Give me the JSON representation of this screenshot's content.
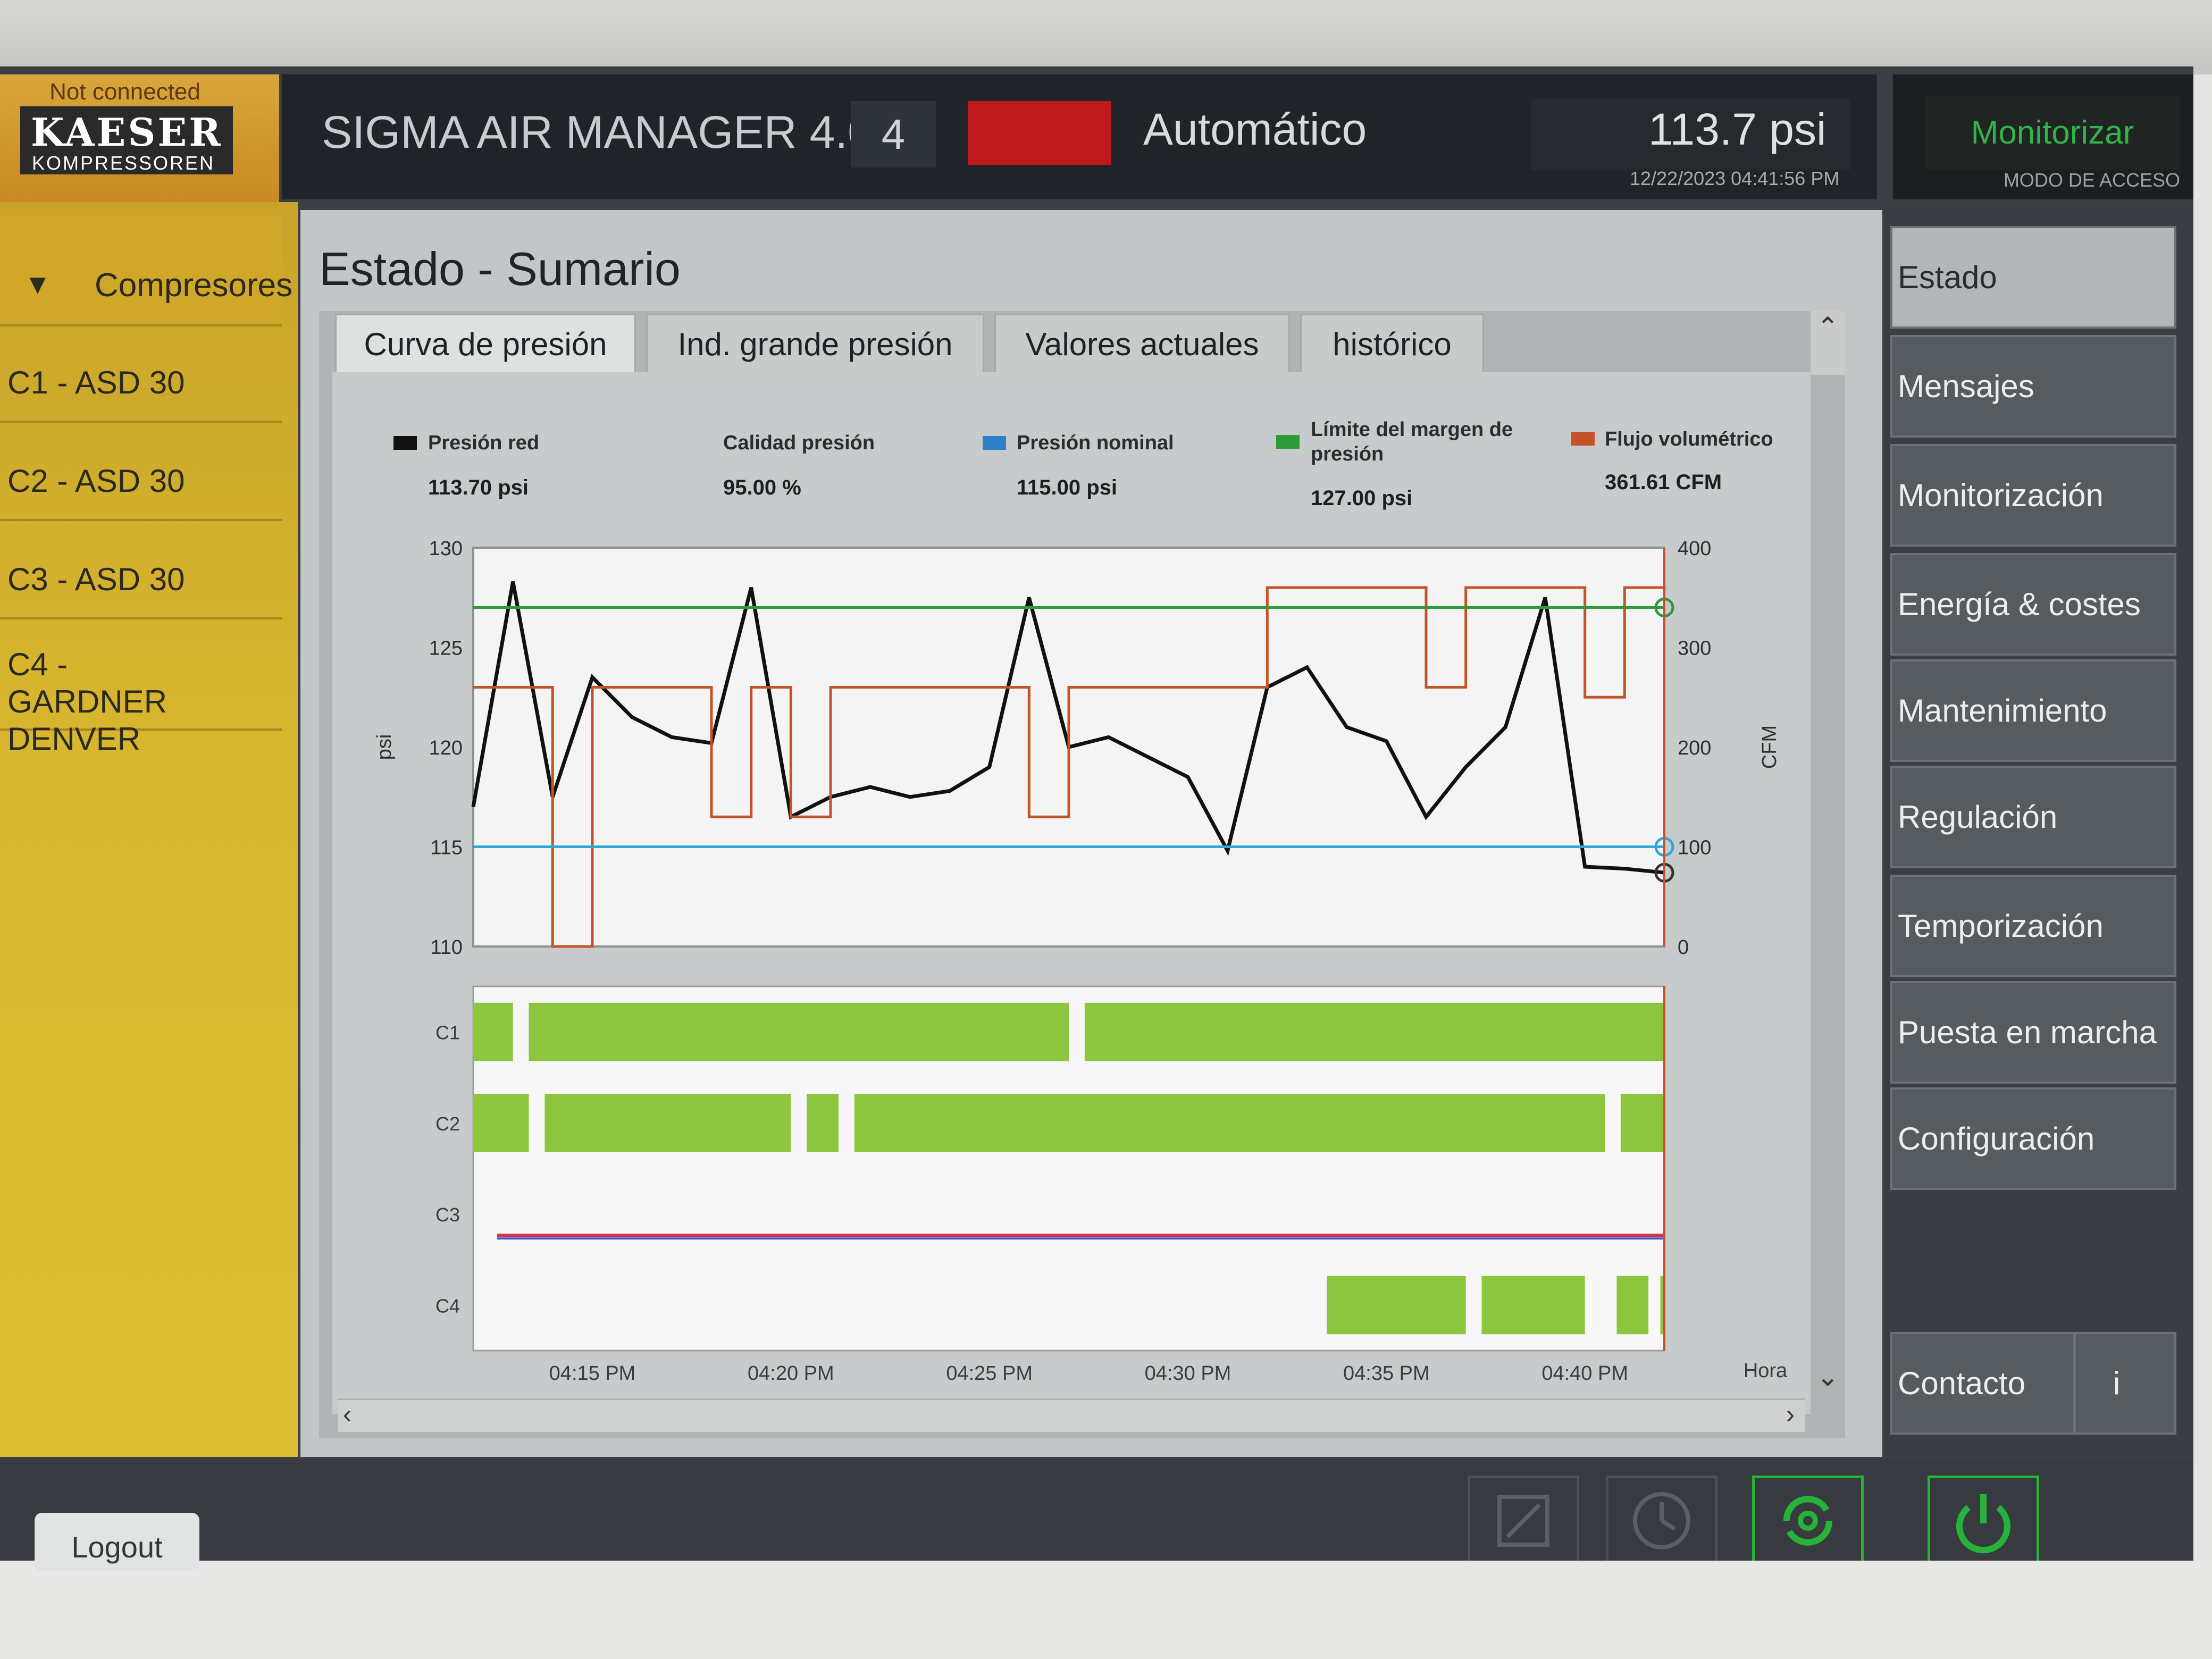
{
  "header": {
    "connection_status": "Not connected",
    "brand": "KAESER",
    "brand_sub": "KOMPRESSOREN",
    "app_title": "SIGMA AIR MANAGER 4.0",
    "unit_number": "4",
    "mode": "Automático",
    "pressure": "113.7 psi",
    "datetime": "12/22/2023 04:41:56 PM",
    "access_button": "Monitorizar",
    "access_label": "MODO DE ACCESO",
    "status_color": "#c0191c"
  },
  "sidebar": {
    "group_label": "Compresores",
    "items": [
      {
        "label": "C1 - ASD 30"
      },
      {
        "label": "C2 - ASD 30"
      },
      {
        "label": "C3 - ASD 30"
      },
      {
        "label": "C4 - GARDNER DENVER"
      }
    ]
  },
  "main": {
    "page_title": "Estado - Sumario",
    "tabs": [
      {
        "label": "Curva de presión",
        "active": true
      },
      {
        "label": "Ind. grande presión"
      },
      {
        "label": "Valores actuales"
      },
      {
        "label": "histórico"
      }
    ]
  },
  "legend": [
    {
      "label": "Presión red",
      "value": "113.70 psi",
      "color": "#111111"
    },
    {
      "label": "Calidad presión",
      "value": "95.00 %",
      "color": null
    },
    {
      "label": "Presión nominal",
      "value": "115.00 psi",
      "color": "#2f80c8"
    },
    {
      "label": "Límite del margen de presión",
      "value": "127.00 psi",
      "color": "#2e9a3c"
    },
    {
      "label": "Flujo volumétrico",
      "value": "361.61 CFM",
      "color": "#c4532a"
    }
  ],
  "chart_data": {
    "type": "line",
    "x": [
      "04:12",
      "04:13",
      "04:14",
      "04:15",
      "04:16",
      "04:17",
      "04:18",
      "04:19",
      "04:20",
      "04:21",
      "04:22",
      "04:23",
      "04:24",
      "04:25",
      "04:26",
      "04:27",
      "04:28",
      "04:29",
      "04:30",
      "04:31",
      "04:32",
      "04:33",
      "04:34",
      "04:35",
      "04:36",
      "04:37",
      "04:38",
      "04:39",
      "04:40",
      "04:41",
      "04:42"
    ],
    "xtick_labels": [
      "04:15 PM",
      "04:20 PM",
      "04:25 PM",
      "04:30 PM",
      "04:35 PM",
      "04:40 PM"
    ],
    "xlabel": "Hora",
    "ylabel_left": "psi",
    "ylabel_right": "CFM",
    "ylim_left": [
      110,
      130
    ],
    "ylim_right": [
      0,
      400
    ],
    "yticks_left": [
      "130",
      "125",
      "120",
      "115",
      "110"
    ],
    "yticks_right": [
      "400",
      "300",
      "200",
      "100",
      "0"
    ],
    "series": [
      {
        "name": "Presión red",
        "axis": "left",
        "color": "#111111",
        "values": [
          117.0,
          128.3,
          117.5,
          123.5,
          121.5,
          120.5,
          120.2,
          128.0,
          116.5,
          117.5,
          118.0,
          117.5,
          117.8,
          119.0,
          127.5,
          120.0,
          120.5,
          119.5,
          118.5,
          114.8,
          123.0,
          124.0,
          121.0,
          120.3,
          116.5,
          119.0,
          121.0,
          127.5,
          114.0,
          113.9,
          113.7
        ]
      },
      {
        "name": "Flujo volumétrico",
        "axis": "right",
        "color": "#c4532a",
        "values": [
          260,
          260,
          0,
          260,
          260,
          260,
          130,
          260,
          130,
          260,
          260,
          260,
          260,
          260,
          130,
          260,
          260,
          260,
          260,
          260,
          360,
          360,
          360,
          360,
          260,
          360,
          360,
          360,
          250,
          360,
          361.61
        ]
      },
      {
        "name": "Presión nominal",
        "axis": "left",
        "color": "#2fa8d8",
        "values": [
          115.0,
          115.0
        ]
      },
      {
        "name": "Límite del margen de presión",
        "axis": "left",
        "color": "#2e9a3c",
        "values": [
          127.0,
          127.0
        ]
      }
    ],
    "gantt": {
      "rows": [
        "C1",
        "C2",
        "C3",
        "C4"
      ],
      "color": "#8cc63f"
    },
    "grid": false
  },
  "rightnav": {
    "items": [
      {
        "label": "Estado",
        "active": true
      },
      {
        "label": "Mensajes"
      },
      {
        "label": "Monitorización"
      },
      {
        "label": "Energía & costes"
      },
      {
        "label": "Mantenimiento"
      },
      {
        "label": "Regulación"
      },
      {
        "label": "Temporización"
      },
      {
        "label": "Puesta en marcha"
      },
      {
        "label": "Configuración"
      }
    ],
    "contact_label": "Contacto",
    "info_icon": "i"
  },
  "footer": {
    "logout_label": "Logout",
    "icons": [
      "edit-icon",
      "clock-icon",
      "sync-icon",
      "power-icon"
    ]
  }
}
